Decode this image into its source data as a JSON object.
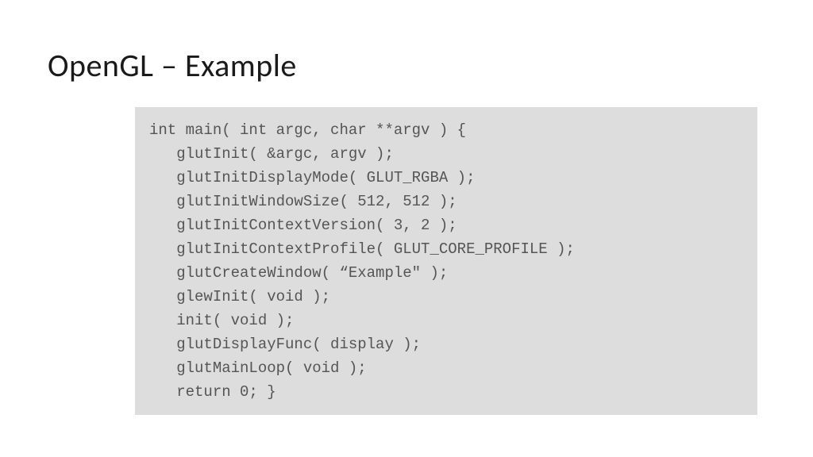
{
  "title": "OpenGL – Example",
  "code": {
    "l0": "int main( int argc, char **argv ) {",
    "l1": "   glutInit( &argc, argv );",
    "l2": "   glutInitDisplayMode( GLUT_RGBA );",
    "l3": "   glutInitWindowSize( 512, 512 );",
    "l4": "   glutInitContextVersion( 3, 2 );",
    "l5": "   glutInitContextProfile( GLUT_CORE_PROFILE );",
    "l6": "   glutCreateWindow( “Example\" );",
    "l7": "   glewInit( void );",
    "l8": "   init( void );",
    "l9": "   glutDisplayFunc( display );",
    "l10": "   glutMainLoop( void );",
    "l11": "   return 0; }"
  }
}
